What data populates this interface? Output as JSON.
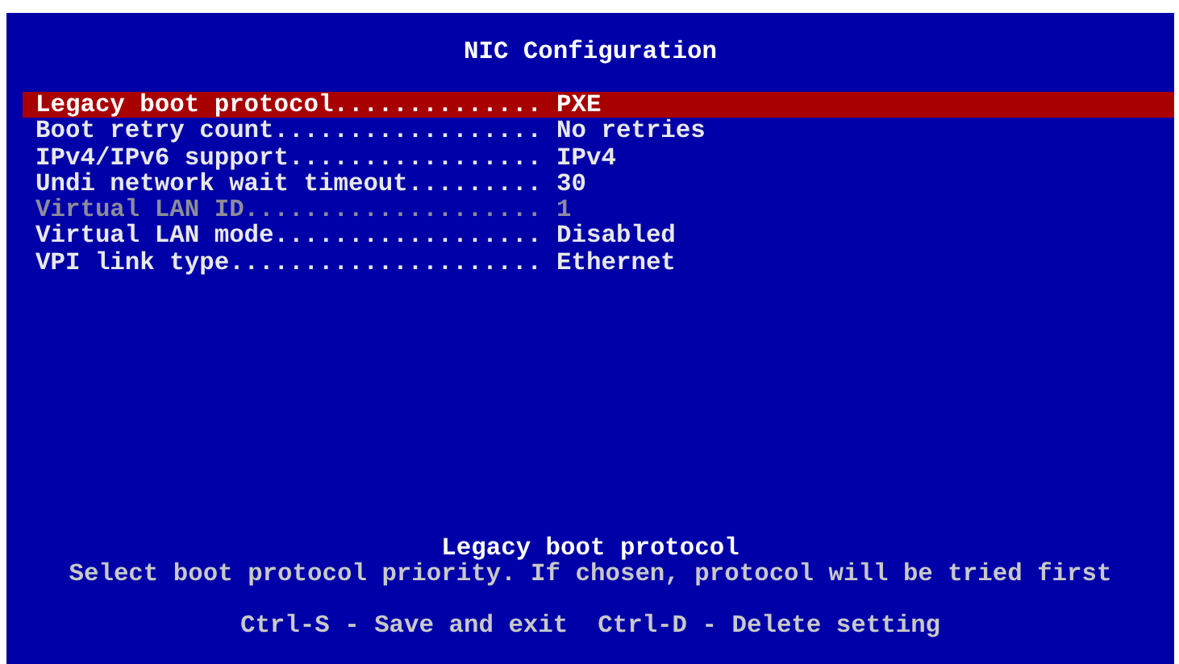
{
  "title": "NIC Configuration",
  "settings": [
    {
      "label": "Legacy boot protocol..............",
      "value": "PXE",
      "selected": true,
      "disabled": false
    },
    {
      "label": "Boot retry count..................",
      "value": "No retries",
      "selected": false,
      "disabled": false
    },
    {
      "label": "IPv4/IPv6 support.................",
      "value": "IPv4",
      "selected": false,
      "disabled": false
    },
    {
      "label": "Undi network wait timeout.........",
      "value": "30",
      "selected": false,
      "disabled": false
    },
    {
      "label": "Virtual LAN ID....................",
      "value": "1",
      "selected": false,
      "disabled": true
    },
    {
      "label": "Virtual LAN mode..................",
      "value": "Disabled",
      "selected": false,
      "disabled": false
    },
    {
      "label": "VPI link type.....................",
      "value": "Ethernet",
      "selected": false,
      "disabled": false
    }
  ],
  "help": {
    "title": "Legacy boot protocol",
    "text": "Select boot protocol priority. If chosen, protocol will be tried first"
  },
  "keys": "Ctrl-S - Save and exit  Ctrl-D - Delete setting"
}
